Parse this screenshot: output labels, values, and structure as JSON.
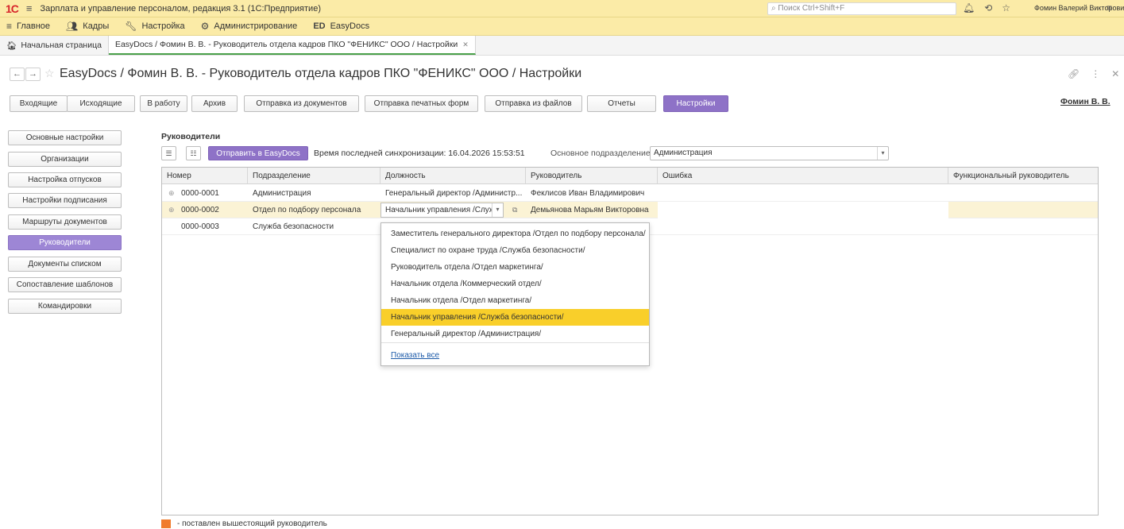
{
  "app": {
    "logo": "1С",
    "title": "Зарплата и управление персоналом, редакция 3.1  (1С:Предприятие)",
    "search_placeholder": "Поиск Ctrl+Shift+F",
    "user": "Фомин Валерий Викторович"
  },
  "menu": [
    {
      "label": "Главное",
      "icon": "hamburger-icon"
    },
    {
      "label": "Кадры",
      "icon": "people-icon"
    },
    {
      "label": "Настройка",
      "icon": "wrench-icon"
    },
    {
      "label": "Администрирование",
      "icon": "gear-icon"
    },
    {
      "label": "EasyDocs",
      "icon": "ed-logo-icon"
    }
  ],
  "tabs": [
    {
      "label": "Начальная страница"
    },
    {
      "label": "EasyDocs / Фомин В. В. - Руководитель отдела кадров ПКО \"ФЕНИКС\" ООО / Настройки"
    }
  ],
  "page": {
    "title": "EasyDocs / Фомин В. В. - Руководитель отдела кадров ПКО \"ФЕНИКС\" ООО / Настройки",
    "user_link": "Фомин В. В."
  },
  "toolbar": [
    {
      "label": "Входящие"
    },
    {
      "label": "Исходящие"
    },
    {
      "label": "В работу"
    },
    {
      "label": "Архив"
    },
    {
      "label": "Отправка из документов"
    },
    {
      "label": "Отправка печатных форм"
    },
    {
      "label": "Отправка из файлов"
    },
    {
      "label": "Отчеты"
    },
    {
      "label": "Настройки"
    }
  ],
  "left_nav": [
    {
      "label": "Основные настройки"
    },
    {
      "label": "Организации"
    },
    {
      "label": "Настройка отпусков"
    },
    {
      "label": "Настройки подписания"
    },
    {
      "label": "Маршруты документов"
    },
    {
      "label": "Руководители"
    },
    {
      "label": "Документы списком"
    },
    {
      "label": "Сопоставление шаблонов"
    },
    {
      "label": "Командировки"
    }
  ],
  "section": {
    "title": "Руководители",
    "send_label": "Отправить в EasyDocs",
    "sync_text": "Время последней синхронизации: 16.04.2026 15:53:51",
    "dept_label": "Основное подразделение:",
    "dept_value": "Администрация"
  },
  "table": {
    "headers": [
      "Номер",
      "Подразделение",
      "Должность",
      "Руководитель",
      "Ошибка",
      "Функциональный руководитель"
    ],
    "rows": [
      {
        "number": "0000-0001",
        "dept": "Администрация",
        "position": "Генеральный директор /Администр...",
        "manager": "Феклисов Иван Владимирович",
        "error": "",
        "func": ""
      },
      {
        "number": "0000-0002",
        "dept": "Отдел по подбору персонала",
        "position": "Начальник управления /Служба",
        "manager": "Демьянова Марьям Викторовна",
        "error": "",
        "func": ""
      },
      {
        "number": "0000-0003",
        "dept": "Служба безопасности",
        "position": "",
        "manager": "",
        "error": "",
        "func": ""
      }
    ]
  },
  "dropdown": {
    "items": [
      "Заместитель генерального директора /Отдел по подбору персонала/",
      "Специалист по охране труда /Служба безопасности/",
      "Руководитель отдела /Отдел маркетинга/",
      "Начальник отдела /Коммерческий отдел/",
      "Начальник отдела /Отдел маркетинга/",
      "Начальник управления /Служба безопасности/",
      "Генеральный директор /Администрация/"
    ],
    "show_all": "Показать все"
  },
  "legend": {
    "text": "- поставлен вышестоящий руководитель",
    "color": "#f07c2c"
  }
}
